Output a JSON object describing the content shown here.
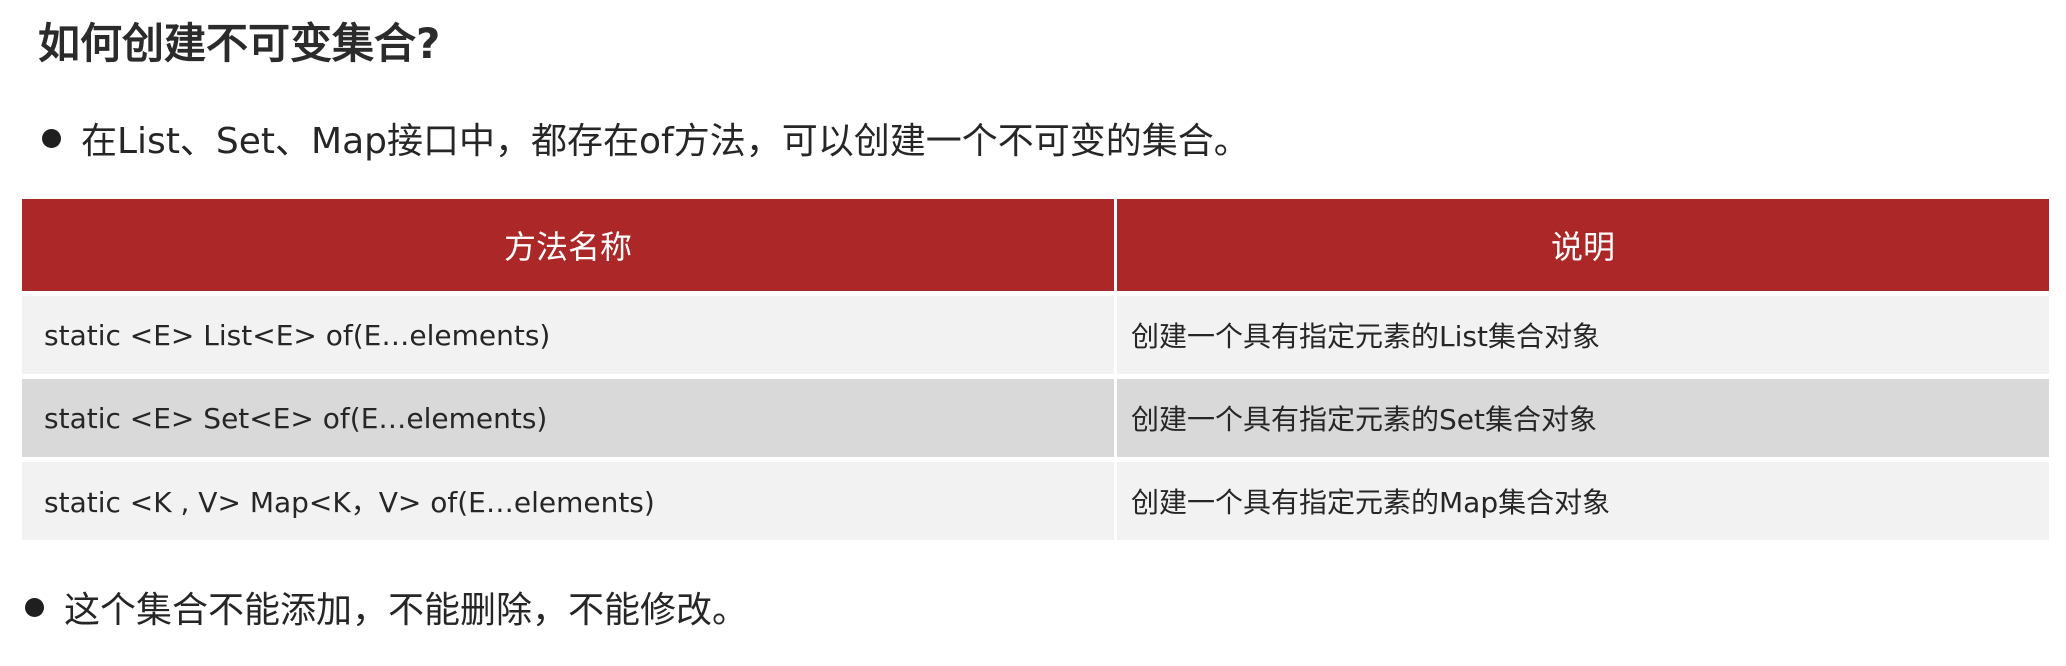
{
  "title": "如何创建不可变集合?",
  "bullets": {
    "intro": "在List、Set、Map接口中，都存在of方法，可以创建一个不可变的集合。",
    "note": "这个集合不能添加，不能删除，不能修改。"
  },
  "table": {
    "headers": {
      "method": "方法名称",
      "description": "说明"
    },
    "rows": [
      {
        "method": "static <E>  List<E>  of(E…elements)",
        "description": "创建一个具有指定元素的List集合对象"
      },
      {
        "method": "static <E>  Set<E>  of(E…elements)",
        "description": "创建一个具有指定元素的Set集合对象"
      },
      {
        "method": "static <K , V>   Map<K，V>  of(E…elements)",
        "description": "创建一个具有指定元素的Map集合对象"
      }
    ]
  },
  "colors": {
    "header_background": "#ac2828",
    "row_light": "#f2f2f2",
    "row_dark": "#d9d9d9"
  }
}
